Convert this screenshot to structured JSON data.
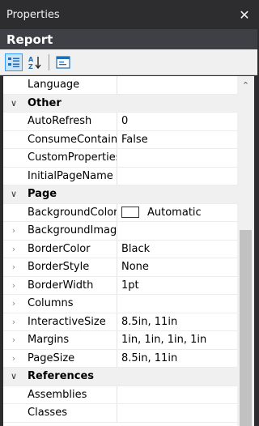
{
  "window": {
    "title": "Properties",
    "close_glyph": "✕"
  },
  "object": {
    "name": "Report"
  },
  "toolbar": {
    "buttons": [
      {
        "name": "categorized-icon",
        "active": true
      },
      {
        "name": "alphabetical-sort-icon",
        "active": false
      },
      {
        "name": "property-pages-icon",
        "active": false
      }
    ]
  },
  "rows": [
    {
      "type": "prop",
      "expander": "",
      "name": "Language",
      "value": ""
    },
    {
      "type": "cat",
      "expander": "∨",
      "name": "Other"
    },
    {
      "type": "prop",
      "expander": "",
      "name": "AutoRefresh",
      "value": "0"
    },
    {
      "type": "prop",
      "expander": "",
      "name": "ConsumeContainerWhitespace",
      "value": "False"
    },
    {
      "type": "prop",
      "expander": "",
      "name": "CustomProperties",
      "value": ""
    },
    {
      "type": "prop",
      "expander": "",
      "name": "InitialPageName",
      "value": ""
    },
    {
      "type": "cat",
      "expander": "∨",
      "name": "Page"
    },
    {
      "type": "prop",
      "expander": "",
      "name": "BackgroundColor",
      "value": "Automatic",
      "swatch": "#ffffff"
    },
    {
      "type": "prop",
      "expander": "›",
      "name": "BackgroundImage",
      "value": ""
    },
    {
      "type": "prop",
      "expander": "›",
      "name": "BorderColor",
      "value": "Black"
    },
    {
      "type": "prop",
      "expander": "›",
      "name": "BorderStyle",
      "value": "None"
    },
    {
      "type": "prop",
      "expander": "›",
      "name": "BorderWidth",
      "value": "1pt"
    },
    {
      "type": "prop",
      "expander": "›",
      "name": "Columns",
      "value": ""
    },
    {
      "type": "prop",
      "expander": "›",
      "name": "InteractiveSize",
      "value": "8.5in, 11in"
    },
    {
      "type": "prop",
      "expander": "›",
      "name": "Margins",
      "value": "1in, 1in, 1in, 1in"
    },
    {
      "type": "prop",
      "expander": "›",
      "name": "PageSize",
      "value": "8.5in, 11in"
    },
    {
      "type": "cat",
      "expander": "∨",
      "name": "References"
    },
    {
      "type": "prop",
      "expander": "",
      "name": "Assemblies",
      "value": ""
    },
    {
      "type": "prop",
      "expander": "",
      "name": "Classes",
      "value": ""
    }
  ],
  "scrollbar": {
    "up_glyph": "⌃",
    "position": 0.45
  }
}
